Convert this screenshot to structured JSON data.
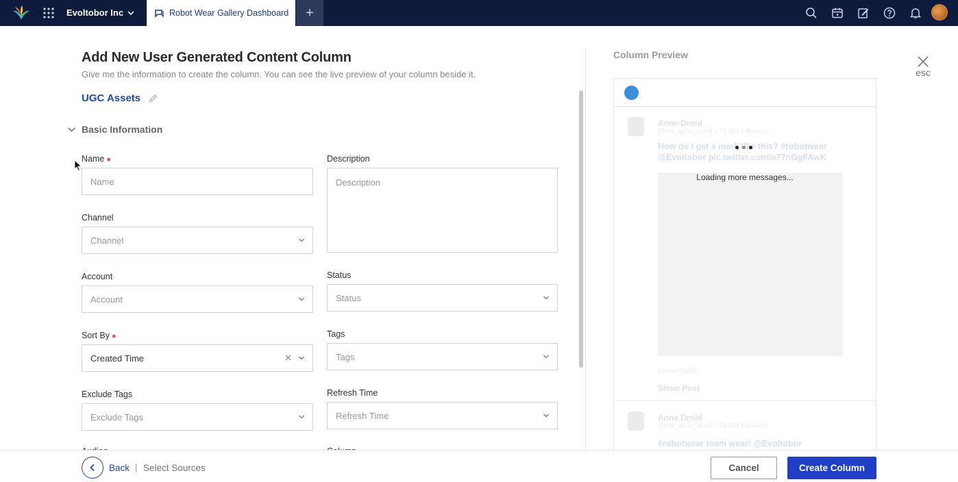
{
  "topbar": {
    "org_name": "Evoltobor Inc",
    "active_tab": "Robot Wear Gallery Dashboard",
    "add_tab": "+",
    "icons": [
      "search-icon",
      "calendar-icon",
      "compose-icon",
      "help-icon",
      "bell-icon"
    ]
  },
  "form": {
    "title": "Add New User Generated Content Column",
    "subtitle": "Give me the information to create the column. You can see the live preview of your column beside it.",
    "column_type": "UGC Assets",
    "section": "Basic Information",
    "fields": {
      "name": {
        "label": "Name",
        "placeholder": "Name",
        "required": true
      },
      "description": {
        "label": "Description",
        "placeholder": "Description"
      },
      "channel": {
        "label": "Channel",
        "placeholder": "Channel"
      },
      "account": {
        "label": "Account",
        "placeholder": "Account"
      },
      "status": {
        "label": "Status",
        "placeholder": "Status"
      },
      "sort_by": {
        "label": "Sort By",
        "value": "Created Time",
        "required": true
      },
      "tags": {
        "label": "Tags",
        "placeholder": "Tags"
      },
      "exclude_tags": {
        "label": "Exclude Tags",
        "placeholder": "Exclude Tags"
      },
      "refresh_time": {
        "label": "Refresh Time",
        "placeholder": "Refresh Time"
      }
    }
  },
  "preview": {
    "title": "Column Preview",
    "close_hint": "esc",
    "loading_text": "Loading more messages...",
    "ghost_post_1": {
      "name": "Anne Droid",
      "handle": "@the_anne_droid • 79,321 followers",
      "text": "How do I get a mark like this? #robotwear @Evoltobor pic.twitter.com/o77nGgFAwK",
      "meta": "Conversation",
      "action": "Show Post"
    },
    "ghost_post_2": {
      "name": "Anne Droid",
      "handle": "@the_anne_droid • 79,321 followers",
      "text": "#robotwear team wear! @Evoltobor"
    }
  },
  "footer": {
    "back_label": "Back",
    "separator": "|",
    "step_label": "Select Sources",
    "cancel_label": "Cancel",
    "create_label": "Create Column"
  },
  "colors": {
    "topbar_bg": "#0f1b3d",
    "accent": "#1f4aa6",
    "primary_button": "#1f3fc7",
    "required_mark": "#d9534f"
  }
}
